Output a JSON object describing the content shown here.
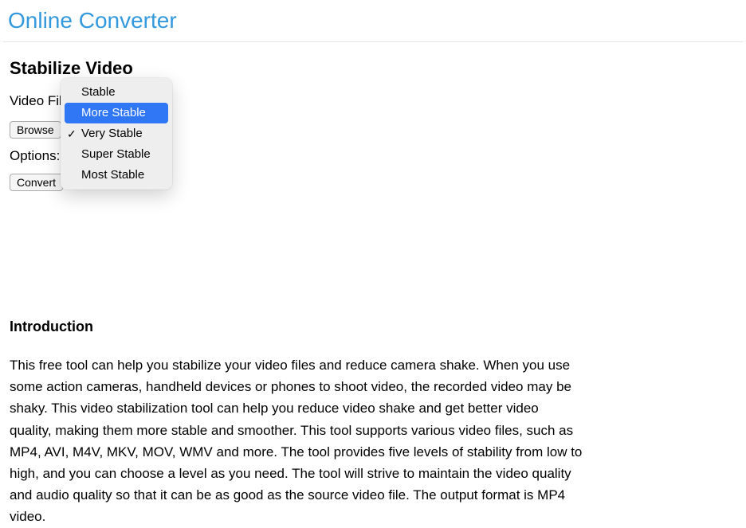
{
  "site_title": "Online Converter",
  "page_heading": "Stabilize Video",
  "form": {
    "video_file_label": "Video File:",
    "browse_button": "Browse",
    "options_label": "Options:",
    "convert_button": "Convert"
  },
  "dropdown": {
    "options": [
      {
        "label": "Stable",
        "selected": false,
        "highlighted": false
      },
      {
        "label": "More Stable",
        "selected": false,
        "highlighted": true
      },
      {
        "label": "Very Stable",
        "selected": true,
        "highlighted": false
      },
      {
        "label": "Super Stable",
        "selected": false,
        "highlighted": false
      },
      {
        "label": "Most Stable",
        "selected": false,
        "highlighted": false
      }
    ]
  },
  "introduction": {
    "heading": "Introduction",
    "body": "This free tool can help you stabilize your video files and reduce camera shake. When you use some action cameras, handheld devices or phones to shoot video, the recorded video may be shaky. This video stabilization tool can help you reduce video shake and get better video quality, making them more stable and smoother. This tool supports various video files, such as MP4, AVI, M4V, MKV, MOV, WMV and more. The tool provides five levels of stability from low to high, and you can choose a level as you need. The tool will strive to maintain the video quality and audio quality so that it can be as good as the source video file. The output format is MP4 video."
  }
}
